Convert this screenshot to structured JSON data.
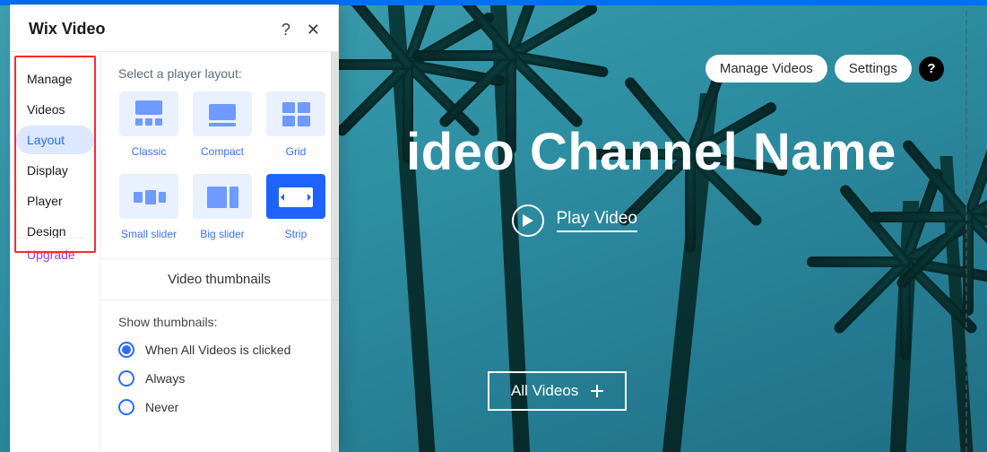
{
  "panel": {
    "title": "Wix Video",
    "help": "?",
    "close": "✕",
    "nav": [
      "Manage",
      "Videos",
      "Layout",
      "Display",
      "Player",
      "Design"
    ],
    "nav_active_index": 2,
    "upgrade": "Upgrade"
  },
  "layout": {
    "prompt": "Select a player layout:",
    "options": [
      "Classic",
      "Compact",
      "Grid",
      "Small slider",
      "Big slider",
      "Strip"
    ],
    "selected_index": 5
  },
  "thumbnails": {
    "title": "Video thumbnails",
    "prompt": "Show thumbnails:",
    "options": [
      "When All Videos is clicked",
      "Always",
      "Never"
    ],
    "selected_index": 0
  },
  "preview": {
    "manage_label": "Manage Videos",
    "settings_label": "Settings",
    "title": "ideo Channel Name",
    "play_label": "Play Video",
    "all_videos_label": "All Videos"
  }
}
